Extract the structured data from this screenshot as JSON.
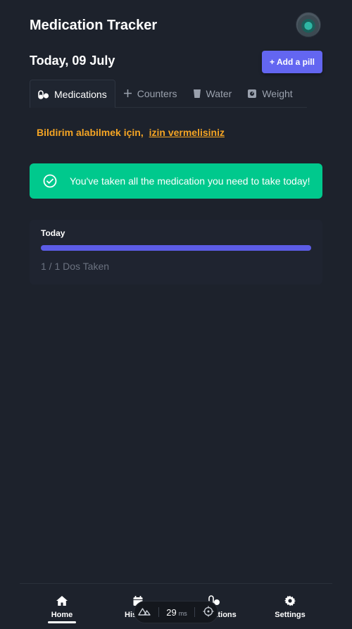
{
  "header": {
    "title": "Medication Tracker"
  },
  "date_title": "Today, 09 July",
  "add_button_label": "+ Add a pill",
  "tabs": [
    {
      "label": "Medications",
      "icon": "pills-icon",
      "active": true
    },
    {
      "label": "Counters",
      "icon": "plus-icon",
      "active": false
    },
    {
      "label": "Water",
      "icon": "glass-icon",
      "active": false
    },
    {
      "label": "Weight",
      "icon": "scale-icon",
      "active": false
    }
  ],
  "notice": {
    "text": "Bildirim alabilmek için,",
    "link": "izin vermelisiniz",
    "color": "#f5a524"
  },
  "success": {
    "message": "You've taken all the medication you need to take today!",
    "color": "#00c98d"
  },
  "progress": {
    "label": "Today",
    "count_text": "1 / 1 Dos Taken",
    "fraction": 1.0,
    "color": "#5c5ce6"
  },
  "bottom_nav": [
    {
      "label": "Home",
      "icon": "home-icon",
      "active": true
    },
    {
      "label": "History",
      "icon": "calendar-icon",
      "active": false
    },
    {
      "label": "Medications",
      "icon": "pills-icon",
      "active": false
    },
    {
      "label": "Settings",
      "icon": "gear-icon",
      "active": false
    }
  ],
  "devbar": {
    "value": "29",
    "unit": "ms"
  }
}
